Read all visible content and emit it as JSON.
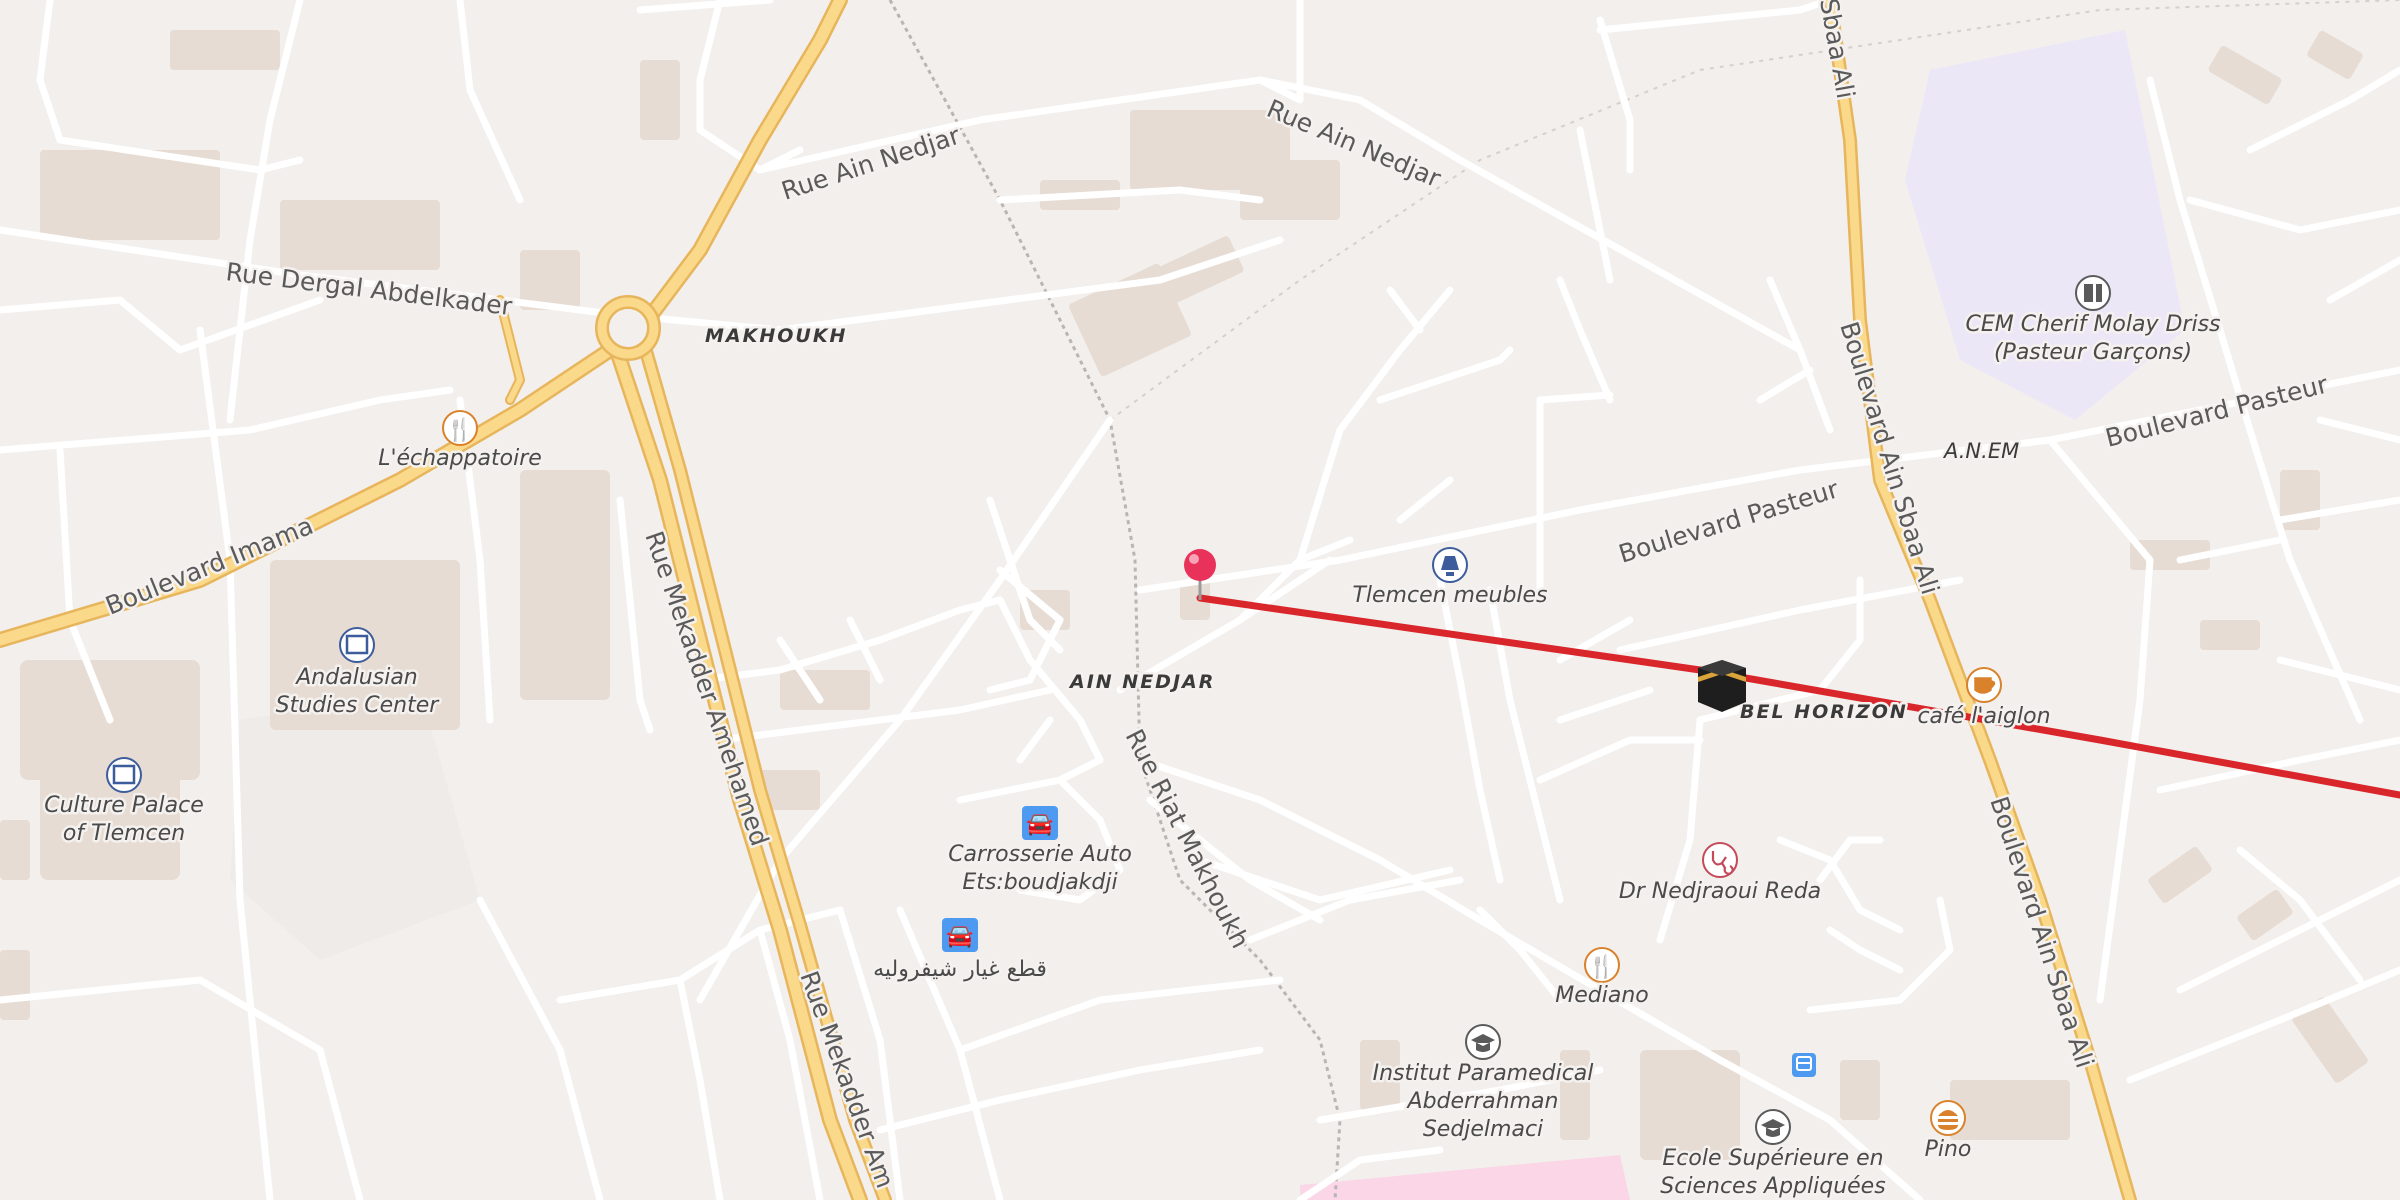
{
  "streets": {
    "rue_ain_nedjar_1": "Rue Ain Nedjar",
    "rue_ain_nedjar_2": "Rue Ain Nedjar",
    "rue_dergal": "Rue Dergal Abdelkader",
    "boulevard_imama": "Boulevard Imama",
    "rue_mekadder_1": "Rue Mekadder Amehamed",
    "rue_mekadder_2": "Rue Mekadder Am",
    "rue_riat": "Rue Riat Makhoukh",
    "boulevard_pasteur_1": "Boulevard Pasteur",
    "boulevard_pasteur_2": "Boulevard Pasteur",
    "boulevard_ain_sbaa_1": "Boulevard Ain Sbaa Ali",
    "boulevard_ain_sbaa_2": "Boulevard Ain Sbaa Ali",
    "boulevard_ain_sbaa_top": "Sbaa Ali"
  },
  "districts": {
    "makhoukh": "MAKHOUKH",
    "ain_nedjar": "AIN NEDJAR",
    "bel_horizon": "BEL HORIZON",
    "anem": "A.N.EM"
  },
  "pois": [
    {
      "name": "L'échappatoire",
      "icon": "restaurant-icon"
    },
    {
      "name": "Andalusian Studies Center",
      "line1": "Andalusian",
      "line2": "Studies Center",
      "icon": "museum-icon"
    },
    {
      "name": "Culture Palace of Tlemcen",
      "line1": "Culture Palace",
      "line2": "of Tlemcen",
      "icon": "museum-icon"
    },
    {
      "name": "Carrosserie Auto Ets:boudjakdji",
      "line1": "Carrosserie Auto",
      "line2": "Ets:boudjakdji",
      "icon": "car-icon"
    },
    {
      "name": "قطع غيار شيفروليه",
      "icon": "car-icon"
    },
    {
      "name": "Tlemcen meubles",
      "icon": "lamp-icon"
    },
    {
      "name": "CEM Cherif Molay Driss (Pasteur Garçons)",
      "line1": "CEM Cherif Molay Driss",
      "line2": "(Pasteur Garçons)",
      "icon": "school-icon"
    },
    {
      "name": "café l'aiglon",
      "icon": "cafe-icon"
    },
    {
      "name": "Dr Nedjraoui Reda",
      "icon": "doctor-icon"
    },
    {
      "name": "Mediano",
      "icon": "restaurant-icon"
    },
    {
      "name": "Institut Paramedical Abderrahman Sedjelmaci",
      "line1": "Institut Paramedical",
      "line2": "Abderrahman",
      "line3": "Sedjelmaci",
      "icon": "graduation-icon"
    },
    {
      "name": "Ecole Supérieure en Sciences Appliquées",
      "line1": "Ecole Supérieure en",
      "line2": "Sciences Appliquées",
      "icon": "graduation-icon"
    },
    {
      "name": "Pino",
      "icon": "fastfood-icon"
    }
  ],
  "markers": {
    "pin": "location-pin-icon",
    "kaaba": "kaaba-icon",
    "bus": "bus-stop-icon"
  },
  "colors": {
    "background": "#f2efed",
    "road": "#ffffff",
    "major_road": "#fbd98a",
    "major_road_casing": "#e7b55c",
    "building": "#e6dcd3",
    "route_line": "#d9262b",
    "pin": "#e8325a",
    "school_area": "#ece7f7",
    "hospital_area": "#fbd6e6",
    "poi_icon_orange": "#d9822b",
    "poi_icon_blue": "#4e9af1"
  }
}
